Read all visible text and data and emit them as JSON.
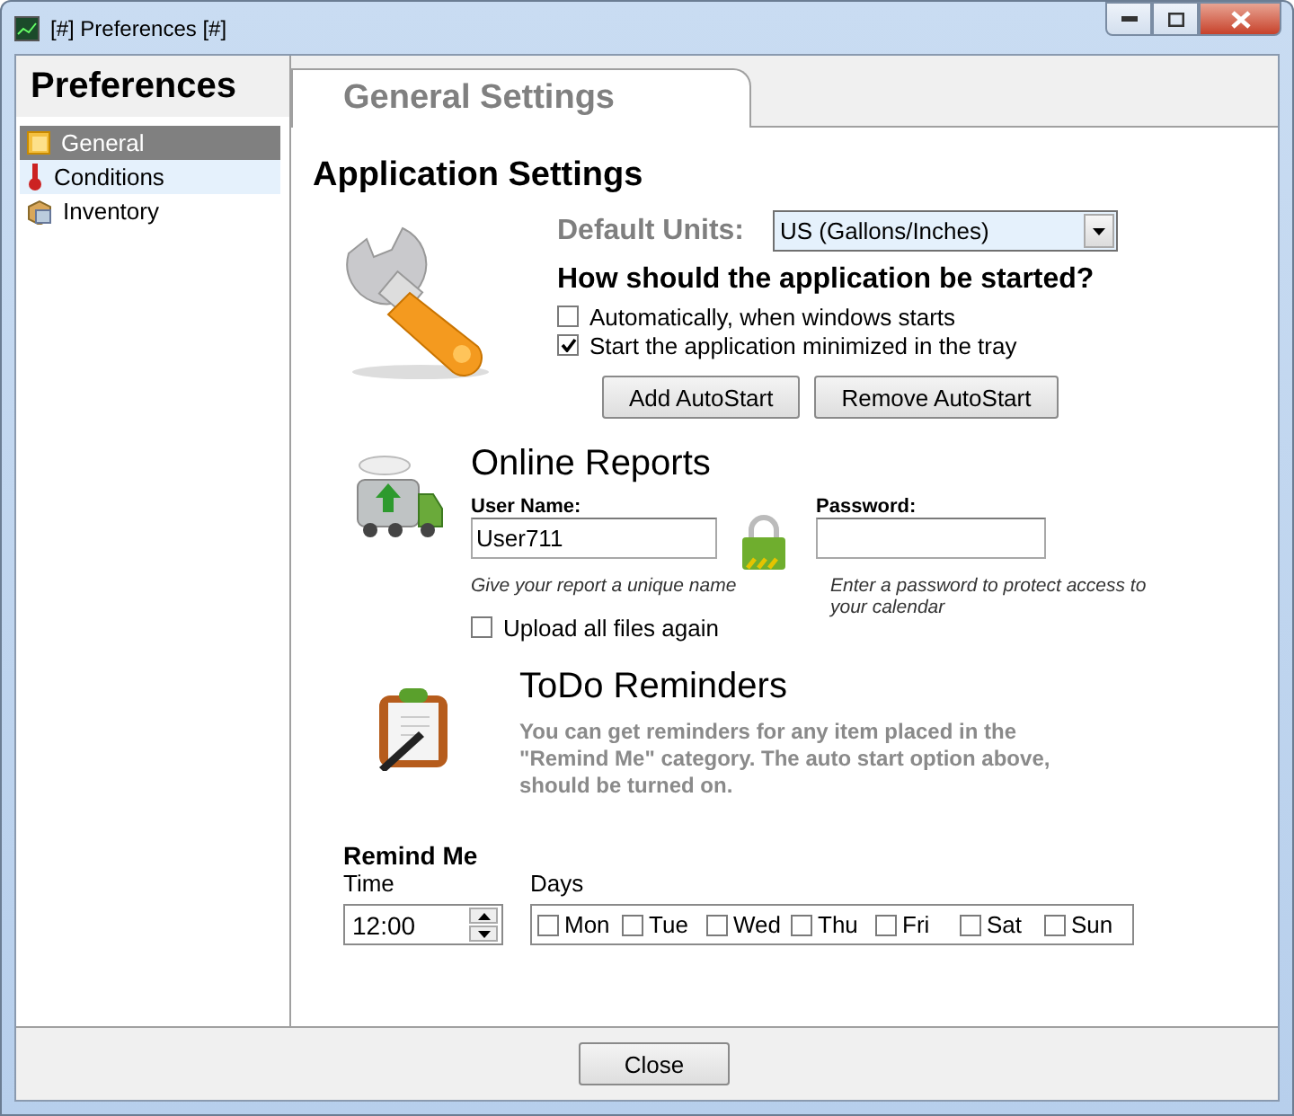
{
  "window": {
    "title": "[#] Preferences [#]"
  },
  "sidebar": {
    "title": "Preferences",
    "items": [
      {
        "label": "General",
        "selected": true,
        "hovered": false,
        "kind": "general"
      },
      {
        "label": "Conditions",
        "selected": false,
        "hovered": true,
        "kind": "conditions"
      },
      {
        "label": "Inventory",
        "selected": false,
        "hovered": false,
        "kind": "inventory"
      }
    ]
  },
  "tab": {
    "label": "General Settings"
  },
  "application": {
    "title": "Application Settings",
    "units_label": "Default Units:",
    "units_value": "US (Gallons/Inches)",
    "question": "How should the application be started?",
    "options": [
      {
        "label": "Automatically, when windows starts",
        "checked": false
      },
      {
        "label": "Start the application minimized in the tray",
        "checked": true
      }
    ],
    "buttons": [
      "Add AutoStart",
      "Remove AutoStart"
    ]
  },
  "reports": {
    "title": "Online Reports",
    "user_label": "User Name:",
    "user_value": "User711",
    "user_hint": "Give your report a unique name",
    "password_label": "Password:",
    "password_hint": "Enter a password to protect access to your calendar",
    "upload": {
      "label": "Upload all files again",
      "checked": false
    }
  },
  "todo": {
    "title": "ToDo Reminders",
    "description": "You can get reminders for any item placed in the \"Remind Me\" category. The auto start option above, should be turned on."
  },
  "remind": {
    "title": "Remind Me",
    "time_label": "Time",
    "time_value": "12:00",
    "days_label": "Days",
    "days": [
      {
        "label": "Mon",
        "checked": false
      },
      {
        "label": "Tue",
        "checked": false
      },
      {
        "label": "Wed",
        "checked": false
      },
      {
        "label": "Thu",
        "checked": false
      },
      {
        "label": "Fri",
        "checked": false
      },
      {
        "label": "Sat",
        "checked": false
      },
      {
        "label": "Sun",
        "checked": false
      }
    ]
  },
  "footer": {
    "button": "Close"
  }
}
